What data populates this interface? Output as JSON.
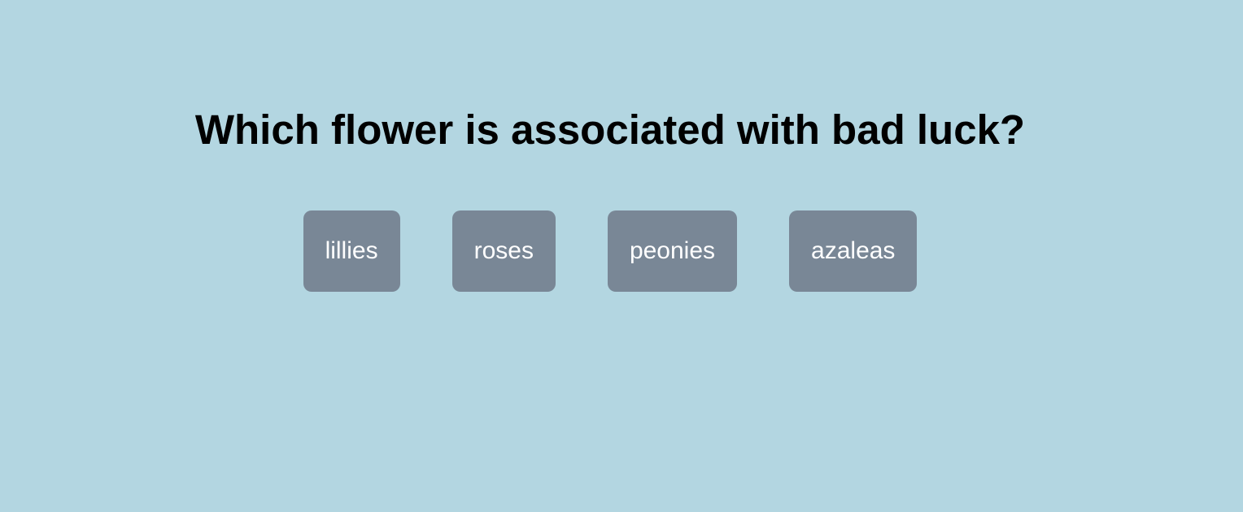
{
  "quiz": {
    "question": "Which flower is associated with bad luck?",
    "answers": [
      {
        "label": "lillies"
      },
      {
        "label": "roses"
      },
      {
        "label": "peonies"
      },
      {
        "label": "azaleas"
      }
    ]
  },
  "colors": {
    "background": "#b3d6e1",
    "button": "#798796",
    "button_text": "#ffffff",
    "question_text": "#000000"
  }
}
